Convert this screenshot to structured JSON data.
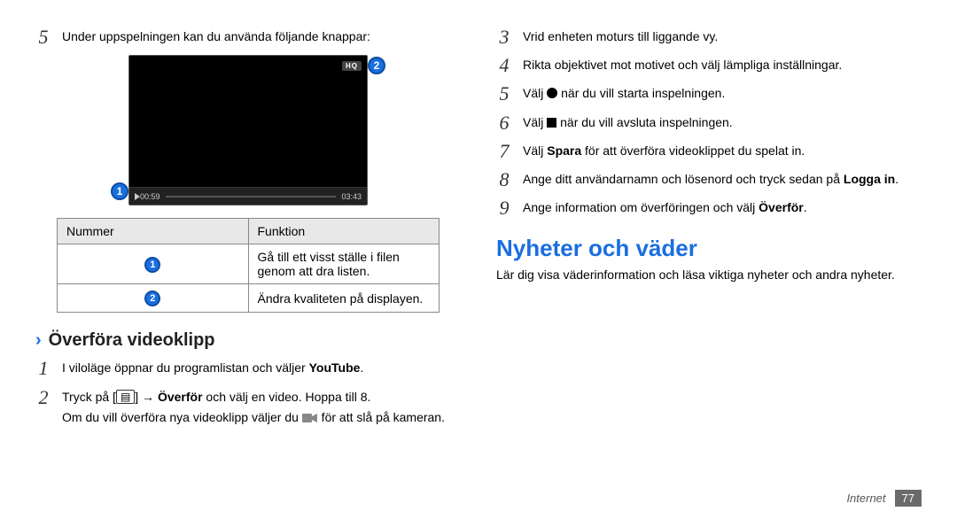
{
  "left": {
    "step5_intro": "Under uppspelningen kan du använda följande knappar:",
    "video": {
      "hq": "HQ",
      "time_current": "00:59",
      "time_total": "03:43",
      "callout1": "1",
      "callout2": "2"
    },
    "table": {
      "head_num": "Nummer",
      "head_func": "Funktion",
      "row1_num": "1",
      "row1_text": "Gå till ett visst ställe i filen genom att dra listen.",
      "row2_num": "2",
      "row2_text": "Ändra kvaliteten på displayen."
    },
    "subhead": "Överföra videoklipp",
    "s1_a": "I viloläge öppnar du programlistan och väljer ",
    "s1_b": "YouTube",
    "s1_c": ".",
    "s2_a": "Tryck på [",
    "s2_menu": "▤",
    "s2_b": "] → ",
    "s2_bold": "Överför",
    "s2_c": " och välj en video. Hoppa till 8.",
    "s2_p2a": "Om du vill överföra nya videoklipp väljer du ",
    "s2_p2b": " för att slå på kameran."
  },
  "right": {
    "s3": "Vrid enheten moturs till liggande vy.",
    "s4": "Rikta objektivet mot motivet och välj lämpliga inställningar.",
    "s5a": "Välj ",
    "s5b": " när du vill starta inspelningen.",
    "s6a": "Välj ",
    "s6b": " när du vill avsluta inspelningen.",
    "s7a": "Välj ",
    "s7b": "Spara",
    "s7c": " för att överföra videoklippet du spelat in.",
    "s8a": "Ange ditt användarnamn och lösenord och tryck sedan på ",
    "s8b": "Logga in",
    "s8c": ".",
    "s9a": "Ange information om överföringen och välj ",
    "s9b": "Överför",
    "s9c": ".",
    "h2": "Nyheter och väder",
    "p": "Lär dig visa väderinformation och läsa viktiga nyheter och andra nyheter."
  },
  "nums": {
    "n1": "1",
    "n2": "2",
    "n3": "3",
    "n4": "4",
    "n5": "5",
    "n6": "6",
    "n7": "7",
    "n8": "8",
    "n9": "9"
  },
  "footer": {
    "section": "Internet",
    "page": "77"
  }
}
